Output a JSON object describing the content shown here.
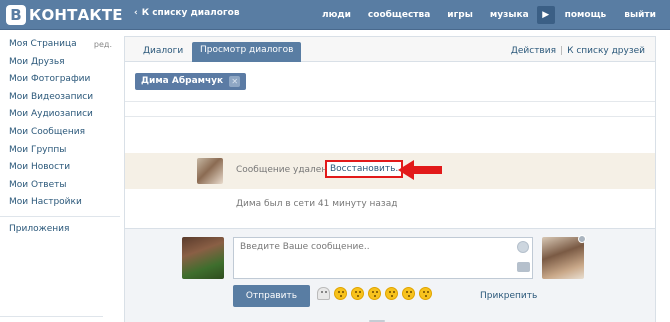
{
  "header": {
    "logo_letter": "В",
    "logo_text": "КОНТАКТЕ",
    "back_link": "К списку диалогов",
    "nav": {
      "people": "люди",
      "communities": "сообщества",
      "games": "игры",
      "music": "музыка",
      "help": "помощь",
      "logout": "выйти"
    }
  },
  "sidebar": {
    "items": [
      {
        "label": "Моя Страница",
        "edit": "ред."
      },
      {
        "label": "Мои Друзья"
      },
      {
        "label": "Мои Фотографии"
      },
      {
        "label": "Мои Видеозаписи"
      },
      {
        "label": "Мои Аудиозаписи"
      },
      {
        "label": "Мои Сообщения"
      },
      {
        "label": "Мои Группы"
      },
      {
        "label": "Мои Новости"
      },
      {
        "label": "Мои Ответы"
      },
      {
        "label": "Мои Настройки"
      }
    ],
    "apps": "Приложения"
  },
  "tabs": {
    "dialogs": "Диалоги",
    "view": "Просмотр диалогов",
    "actions": "Действия",
    "separator": "|",
    "to_friends": "К списку друзей"
  },
  "chip": {
    "name": "Дима Абрамчук",
    "close": "✕"
  },
  "message": {
    "deleted_text": "Сообщение удалено.",
    "restore": "Восстановить.",
    "online_status": "Дима был в сети 41 минуту назад"
  },
  "compose": {
    "placeholder": "Введите Ваше сообщение..",
    "send": "Отправить",
    "attach": "Прикрепить"
  },
  "colors": {
    "brand": "#597da3",
    "link": "#2b587a",
    "highlight_box": "#e21a1a",
    "deleted_bg": "#f5f0e6"
  }
}
